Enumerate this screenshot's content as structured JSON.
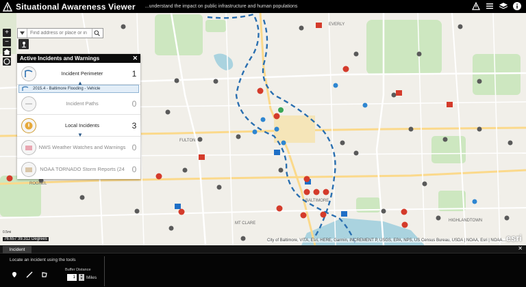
{
  "header": {
    "title": "Situational Awareness Viewer",
    "subtitle": "...understand the impact on public infrastructure and human populations",
    "icons": [
      "alert-icon",
      "list-icon",
      "layers-icon",
      "info-icon"
    ]
  },
  "search": {
    "placeholder": "Find address or place or in"
  },
  "map_labels": {
    "everly": "EVERLY",
    "fulton": "FULTON",
    "rognel": "ROGNEL",
    "baltimore": "BALTIMORE",
    "mt_clare": "MT CLARE",
    "highlandtown": "HIGHLANDTOWN"
  },
  "panel": {
    "title": "Active Incidents and Warnings",
    "rows": [
      {
        "label": "Incident Perimeter",
        "count": "1",
        "active": true
      },
      {
        "label": "Incident Paths",
        "count": "0",
        "active": false
      },
      {
        "label": "Local Incidents",
        "count": "3",
        "active": true
      },
      {
        "label": "NWS Weather Watches and Warnings",
        "count": "0",
        "active": false
      },
      {
        "label": "NOAA TORNADO Storm Reports (24",
        "count": "0",
        "active": false
      }
    ],
    "sub_item": "2015.4 - Baltimore Flooding - Vehicle"
  },
  "map_footer": {
    "attribution": "City of Baltimore, VITA, Esri, HERE, Garmin, INCREMENT P, USGS, EPA, NPS, US Census Bureau, USDA | NOAA, Esri | NOAA...",
    "coords": "76.657 39.312 Degrees",
    "scale": "0.5mi",
    "esri": "esri"
  },
  "bottom": {
    "tab": "Incident",
    "hint": "Locate an incident using the tools",
    "buffer_label": "Buffer Distance",
    "buffer_value": "1",
    "buffer_unit": "Miles"
  },
  "colors": {
    "header_bg": "#000000",
    "water": "#aad3df",
    "park": "#cde7c0",
    "incident_line": "#2a6fb0",
    "marker_red": "#d43b2b",
    "hospital_blue": "#1f6fc6"
  }
}
